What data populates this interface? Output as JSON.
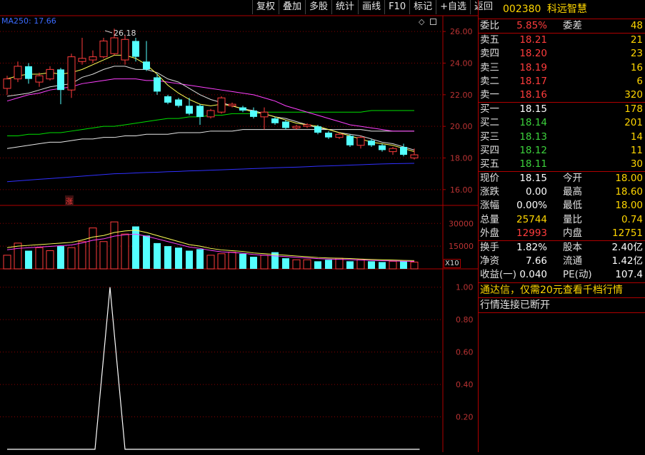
{
  "toolbar": {
    "items": [
      "复权",
      "叠加",
      "多股",
      "统计",
      "画线",
      "F10",
      "标记",
      "+自选",
      "返回"
    ]
  },
  "chart": {
    "ma_label": "MA250: 17.66",
    "high_mark": "26.18",
    "zhang_badge": "涨",
    "price_axis": [
      "26.00",
      "24.00",
      "22.00",
      "20.00",
      "18.00",
      "16.00"
    ],
    "volume_axis": [
      "30000",
      "15000"
    ],
    "volume_unit": "X10",
    "indicator_axis": [
      "1.00",
      "0.80",
      "0.60",
      "0.40",
      "0.20"
    ],
    "colors": {
      "up": "#ff3c3c",
      "down": "#54ffff",
      "ma_short": "#ffffff",
      "ma_yellow": "#ffff55",
      "ma_magenta": "#ff40ff",
      "ma_green": "#00e000",
      "ma_blue": "#3030ff",
      "grid": "#8b0000"
    }
  },
  "chart_data": {
    "type": "candlestick",
    "candles": [
      {
        "o": 22.4,
        "c": 23.0,
        "h": 23.2,
        "l": 22.0,
        "up": true
      },
      {
        "o": 23.0,
        "c": 23.8,
        "h": 24.1,
        "l": 22.8,
        "up": true
      },
      {
        "o": 23.8,
        "c": 23.0,
        "h": 24.0,
        "l": 22.7,
        "up": false
      },
      {
        "o": 22.8,
        "c": 23.2,
        "h": 23.4,
        "l": 22.5,
        "up": true
      },
      {
        "o": 23.0,
        "c": 23.6,
        "h": 23.8,
        "l": 22.9,
        "up": true
      },
      {
        "o": 23.6,
        "c": 22.3,
        "h": 23.7,
        "l": 21.4,
        "up": false
      },
      {
        "o": 22.3,
        "c": 24.4,
        "h": 24.6,
        "l": 21.8,
        "up": true
      },
      {
        "o": 24.1,
        "c": 24.3,
        "h": 25.6,
        "l": 23.9,
        "up": true
      },
      {
        "o": 24.2,
        "c": 24.4,
        "h": 24.8,
        "l": 24.0,
        "up": true
      },
      {
        "o": 24.4,
        "c": 25.4,
        "h": 25.6,
        "l": 24.3,
        "up": true
      },
      {
        "o": 24.6,
        "c": 25.6,
        "h": 26.18,
        "l": 24.5,
        "up": true
      },
      {
        "o": 25.5,
        "c": 24.2,
        "h": 25.8,
        "l": 23.9,
        "up": true
      },
      {
        "o": 25.4,
        "c": 24.4,
        "h": 25.6,
        "l": 24.1,
        "up": false
      },
      {
        "o": 24.1,
        "c": 23.6,
        "h": 25.4,
        "l": 23.5,
        "up": false
      },
      {
        "o": 23.1,
        "c": 22.2,
        "h": 23.3,
        "l": 22.0,
        "up": false
      },
      {
        "o": 21.9,
        "c": 21.5,
        "h": 22.0,
        "l": 21.4,
        "up": false
      },
      {
        "o": 21.7,
        "c": 21.3,
        "h": 21.8,
        "l": 21.2,
        "up": false
      },
      {
        "o": 21.3,
        "c": 20.8,
        "h": 21.8,
        "l": 20.7,
        "up": false
      },
      {
        "o": 21.3,
        "c": 20.6,
        "h": 21.4,
        "l": 20.1,
        "up": false
      },
      {
        "o": 20.6,
        "c": 21.0,
        "h": 21.1,
        "l": 20.5,
        "up": true
      },
      {
        "o": 20.9,
        "c": 21.8,
        "h": 21.9,
        "l": 20.8,
        "up": true
      },
      {
        "o": 21.4,
        "c": 21.3,
        "h": 21.5,
        "l": 21.2,
        "up": true
      },
      {
        "o": 21.2,
        "c": 21.0,
        "h": 21.3,
        "l": 20.9,
        "up": false
      },
      {
        "o": 21.0,
        "c": 20.6,
        "h": 21.2,
        "l": 20.5,
        "up": false
      },
      {
        "o": 20.6,
        "c": 20.9,
        "h": 21.2,
        "l": 19.8,
        "up": true
      },
      {
        "o": 20.5,
        "c": 20.2,
        "h": 20.6,
        "l": 20.1,
        "up": false
      },
      {
        "o": 20.3,
        "c": 19.9,
        "h": 20.4,
        "l": 19.8,
        "up": false
      },
      {
        "o": 19.9,
        "c": 20.0,
        "h": 20.1,
        "l": 19.8,
        "up": true
      },
      {
        "o": 20.0,
        "c": 20.1,
        "h": 20.2,
        "l": 19.9,
        "up": true
      },
      {
        "o": 20.0,
        "c": 19.6,
        "h": 20.1,
        "l": 19.5,
        "up": false
      },
      {
        "o": 19.6,
        "c": 19.3,
        "h": 19.7,
        "l": 19.2,
        "up": false
      },
      {
        "o": 19.3,
        "c": 19.5,
        "h": 19.6,
        "l": 19.2,
        "up": true
      },
      {
        "o": 19.4,
        "c": 18.8,
        "h": 19.5,
        "l": 18.7,
        "up": false
      },
      {
        "o": 18.8,
        "c": 19.3,
        "h": 19.4,
        "l": 18.6,
        "up": true
      },
      {
        "o": 19.1,
        "c": 18.8,
        "h": 19.2,
        "l": 18.7,
        "up": false
      },
      {
        "o": 18.8,
        "c": 18.5,
        "h": 18.9,
        "l": 18.4,
        "up": false
      },
      {
        "o": 18.4,
        "c": 18.6,
        "h": 18.7,
        "l": 18.2,
        "up": true
      },
      {
        "o": 18.7,
        "c": 18.2,
        "h": 18.9,
        "l": 18.1,
        "up": false
      },
      {
        "o": 18.2,
        "c": 18.0,
        "h": 18.6,
        "l": 17.9,
        "up": true
      }
    ],
    "ma_yellow": [
      23.0,
      23.2,
      23.3,
      23.3,
      23.4,
      23.3,
      23.4,
      23.6,
      23.9,
      24.2,
      24.5,
      24.5,
      24.3,
      23.9,
      23.3,
      22.6,
      22.1,
      21.7,
      21.4,
      21.3,
      21.4,
      21.3,
      21.1,
      20.9,
      20.8,
      20.6,
      20.4,
      20.2,
      20.1,
      20.0,
      19.8,
      19.6,
      19.4,
      19.2,
      19.0,
      18.9,
      18.8,
      18.6,
      18.4
    ],
    "ma_white": [
      21.9,
      22.0,
      22.1,
      22.3,
      22.5,
      22.6,
      22.7,
      23.1,
      23.3,
      23.6,
      23.8,
      23.8,
      23.6,
      23.6,
      23.4,
      23.0,
      22.8,
      22.4,
      22.0,
      21.7,
      21.5,
      21.3,
      21.1,
      21.0,
      20.8,
      20.6,
      20.5,
      20.3,
      20.1,
      19.9,
      19.8,
      19.6,
      19.5,
      19.4,
      19.2,
      19.0,
      18.9,
      18.7,
      18.5
    ],
    "ma_magenta": [
      21.6,
      21.8,
      22.0,
      22.1,
      22.3,
      22.4,
      22.5,
      22.7,
      22.8,
      22.9,
      23.0,
      23.0,
      23.0,
      22.9,
      22.9,
      22.8,
      22.7,
      22.6,
      22.5,
      22.4,
      22.3,
      22.2,
      22.1,
      22.0,
      21.8,
      21.6,
      21.3,
      21.1,
      20.9,
      20.7,
      20.5,
      20.3,
      20.1,
      20.0,
      19.9,
      19.8,
      19.7,
      19.7,
      19.7
    ],
    "ma_green": [
      19.4,
      19.4,
      19.5,
      19.5,
      19.6,
      19.6,
      19.7,
      19.8,
      19.9,
      20.0,
      20.0,
      20.1,
      20.2,
      20.3,
      20.4,
      20.5,
      20.5,
      20.6,
      20.6,
      20.7,
      20.7,
      20.8,
      20.8,
      20.8,
      20.9,
      20.9,
      20.9,
      20.9,
      20.9,
      20.9,
      20.9,
      20.9,
      20.9,
      20.9,
      21.0,
      21.0,
      21.0,
      21.0,
      21.0
    ],
    "ma_gray": [
      18.6,
      18.7,
      18.8,
      18.9,
      19.0,
      19.0,
      19.1,
      19.2,
      19.2,
      19.3,
      19.3,
      19.4,
      19.4,
      19.5,
      19.5,
      19.5,
      19.6,
      19.6,
      19.6,
      19.7,
      19.7,
      19.7,
      19.8,
      19.8,
      19.8,
      19.8,
      19.8,
      19.8,
      19.8,
      19.8,
      19.8,
      19.8,
      19.8,
      19.8,
      19.7,
      19.7,
      19.7,
      19.7,
      19.7
    ],
    "ma_blue": [
      16.5,
      16.55,
      16.6,
      16.65,
      16.7,
      16.75,
      16.8,
      16.85,
      16.9,
      16.95,
      17.0,
      17.02,
      17.05,
      17.08,
      17.1,
      17.13,
      17.15,
      17.18,
      17.2,
      17.23,
      17.25,
      17.28,
      17.3,
      17.33,
      17.35,
      17.38,
      17.4,
      17.42,
      17.45,
      17.48,
      17.5,
      17.52,
      17.55,
      17.57,
      17.6,
      17.62,
      17.64,
      17.65,
      17.66
    ],
    "volume": [
      9000,
      17000,
      12000,
      14000,
      12000,
      15000,
      14000,
      18000,
      27000,
      18000,
      31000,
      23000,
      28000,
      22000,
      17000,
      15000,
      14000,
      12000,
      13000,
      9000,
      10000,
      11000,
      10000,
      8000,
      9000,
      11000,
      7000,
      6000,
      6000,
      5000,
      6000,
      7000,
      5000,
      6000,
      5000,
      4500,
      5000,
      5000,
      4500
    ],
    "vol_ma": [
      14000,
      15000,
      15500,
      16000,
      16500,
      17000,
      17500,
      19000,
      21000,
      22000,
      24000,
      25000,
      25500,
      24000,
      22000,
      20000,
      18000,
      16000,
      15000,
      13500,
      12500,
      12000,
      11500,
      10500,
      10000,
      9500,
      9000,
      8500,
      8000,
      7500,
      7200,
      7000,
      6800,
      6500,
      6200,
      6000,
      5800,
      5600,
      5500
    ],
    "indicator": [
      {
        "idx": 0,
        "v": 0
      },
      {
        "idx": 8.2,
        "v": 0
      },
      {
        "idx": 9.6,
        "v": 1.0
      },
      {
        "idx": 11.0,
        "v": 0
      },
      {
        "idx": 38.5,
        "v": 0
      }
    ],
    "price_ylim": [
      15.0,
      27.0
    ],
    "vol_ylim": [
      0,
      40000
    ],
    "ind_ylim": [
      0,
      1.1
    ]
  },
  "panel": {
    "code": "002380",
    "name": "科远智慧",
    "weibi_label": "委比",
    "weibi": "5.85%",
    "weicha_label": "委差",
    "weicha": "48",
    "sells": [
      {
        "label": "卖五",
        "price": "18.21",
        "vol": "21"
      },
      {
        "label": "卖四",
        "price": "18.20",
        "vol": "23"
      },
      {
        "label": "卖三",
        "price": "18.19",
        "vol": "16"
      },
      {
        "label": "卖二",
        "price": "18.17",
        "vol": "6"
      },
      {
        "label": "卖一",
        "price": "18.16",
        "vol": "320"
      }
    ],
    "buys": [
      {
        "label": "买一",
        "price": "18.15",
        "vol": "178",
        "color": "white"
      },
      {
        "label": "买二",
        "price": "18.14",
        "vol": "201",
        "color": "green"
      },
      {
        "label": "买三",
        "price": "18.13",
        "vol": "14",
        "color": "green"
      },
      {
        "label": "买四",
        "price": "18.12",
        "vol": "11",
        "color": "green"
      },
      {
        "label": "买五",
        "price": "18.11",
        "vol": "30",
        "color": "green"
      }
    ],
    "stats1": [
      {
        "l1": "现价",
        "v1": "18.15",
        "c1": "white",
        "l2": "今开",
        "v2": "18.00",
        "c2": "green"
      },
      {
        "l1": "涨跌",
        "v1": "0.00",
        "c1": "white",
        "l2": "最高",
        "v2": "18.60",
        "c2": "red"
      },
      {
        "l1": "涨幅",
        "v1": "0.00%",
        "c1": "white",
        "l2": "最低",
        "v2": "18.00",
        "c2": "green"
      },
      {
        "l1": "总量",
        "v1": "25744",
        "c1": "yellow",
        "l2": "量比",
        "v2": "0.74",
        "c2": "green"
      },
      {
        "l1": "外盘",
        "v1": "12993",
        "c1": "red",
        "l2": "内盘",
        "v2": "12751",
        "c2": "green"
      }
    ],
    "stats2": [
      {
        "l1": "换手",
        "v1": "1.82%",
        "l2": "股本",
        "v2": "2.40亿"
      },
      {
        "l1": "净资",
        "v1": "7.66",
        "l2": "流通",
        "v2": "1.42亿"
      },
      {
        "l1": "收益(一)",
        "v1": "0.040",
        "l2": "PE(动)",
        "v2": "107.4"
      }
    ],
    "promo": "通达信，仅需20元查看千档行情",
    "status": "行情连接已断开"
  }
}
